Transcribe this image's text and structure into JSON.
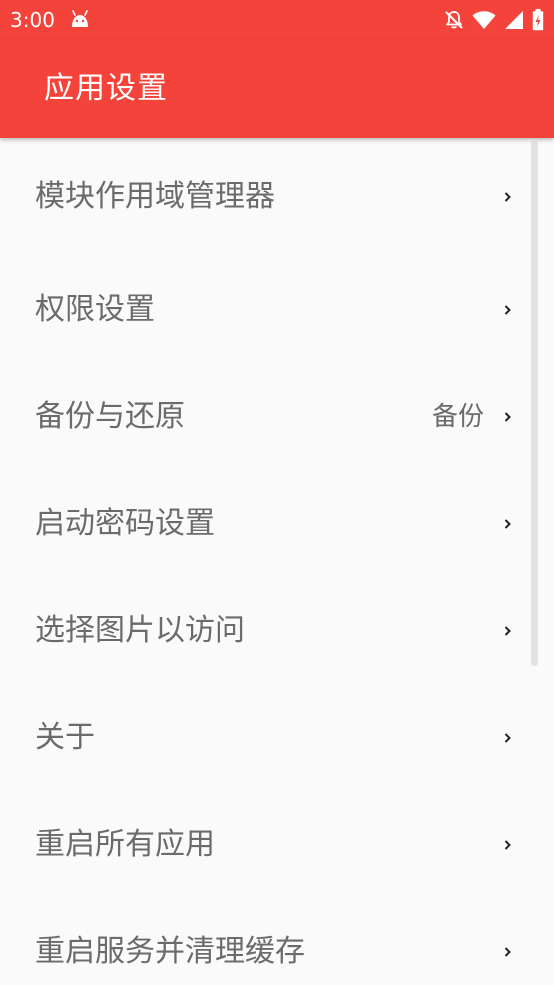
{
  "status_bar": {
    "time": "3:00",
    "icons": [
      "android-icon",
      "bell-off-icon",
      "wifi-icon",
      "signal-icon",
      "battery-charging-icon"
    ]
  },
  "app_bar": {
    "title": "应用设置"
  },
  "settings": {
    "items": [
      {
        "label": "模块作用域管理器",
        "value": ""
      },
      {
        "label": "权限设置",
        "value": ""
      },
      {
        "label": "备份与还原",
        "value": "备份"
      },
      {
        "label": "启动密码设置",
        "value": ""
      },
      {
        "label": "选择图片以访问",
        "value": ""
      },
      {
        "label": "关于",
        "value": ""
      },
      {
        "label": "重启所有应用",
        "value": ""
      },
      {
        "label": "重启服务并清理缓存",
        "value": ""
      }
    ]
  },
  "colors": {
    "accent": "#f4433a",
    "background": "#fafafa",
    "text": "#6b6b6b"
  }
}
